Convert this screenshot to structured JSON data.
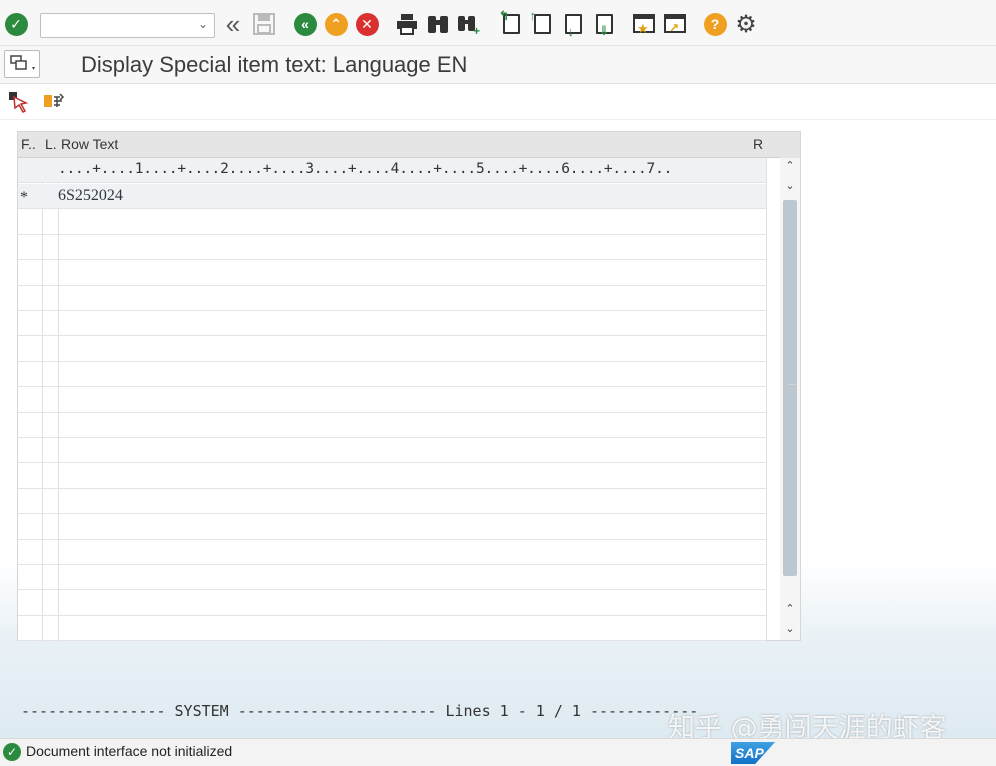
{
  "toolbar": {
    "command_field": {
      "value": "",
      "placeholder": ""
    },
    "icons": [
      "enter-icon",
      "back-double-icon",
      "save-icon",
      "back-icon",
      "exit-icon",
      "cancel-icon",
      "print-icon",
      "find-icon",
      "find-next-icon",
      "first-page-icon",
      "previous-page-icon",
      "next-page-icon",
      "last-page-icon",
      "create-session-icon",
      "generate-shortcut-icon",
      "help-icon",
      "customize-layout-icon"
    ]
  },
  "title": "Display Special item text: Language EN",
  "editor": {
    "columns": {
      "format": "F..",
      "lang": "L.",
      "row_text": "Row Text",
      "r": "R"
    },
    "ruler": "....+....1....+....2....+....3....+....4....+....5....+....6....+....7..",
    "rows": [
      {
        "mark": "*",
        "text": "6S252024"
      },
      {
        "mark": "",
        "text": ""
      },
      {
        "mark": "",
        "text": ""
      },
      {
        "mark": "",
        "text": ""
      },
      {
        "mark": "",
        "text": ""
      },
      {
        "mark": "",
        "text": ""
      },
      {
        "mark": "",
        "text": ""
      },
      {
        "mark": "",
        "text": ""
      },
      {
        "mark": "",
        "text": ""
      },
      {
        "mark": "",
        "text": ""
      },
      {
        "mark": "",
        "text": ""
      },
      {
        "mark": "",
        "text": ""
      },
      {
        "mark": "",
        "text": ""
      },
      {
        "mark": "",
        "text": ""
      },
      {
        "mark": "",
        "text": ""
      },
      {
        "mark": "",
        "text": ""
      },
      {
        "mark": "",
        "text": ""
      },
      {
        "mark": "",
        "text": ""
      }
    ]
  },
  "system_line": "---------------- SYSTEM ---------------------- Lines 1 - 1 / 1 ------------",
  "status": {
    "text": "Document interface not initialized"
  },
  "branding": {
    "logo": "SAP",
    "watermark": "知乎 @勇闯天涯的虾客"
  },
  "colors": {
    "accent_green": "#2b8a3e",
    "cancel_red": "#d93030",
    "exit_orange": "#f0a020"
  }
}
